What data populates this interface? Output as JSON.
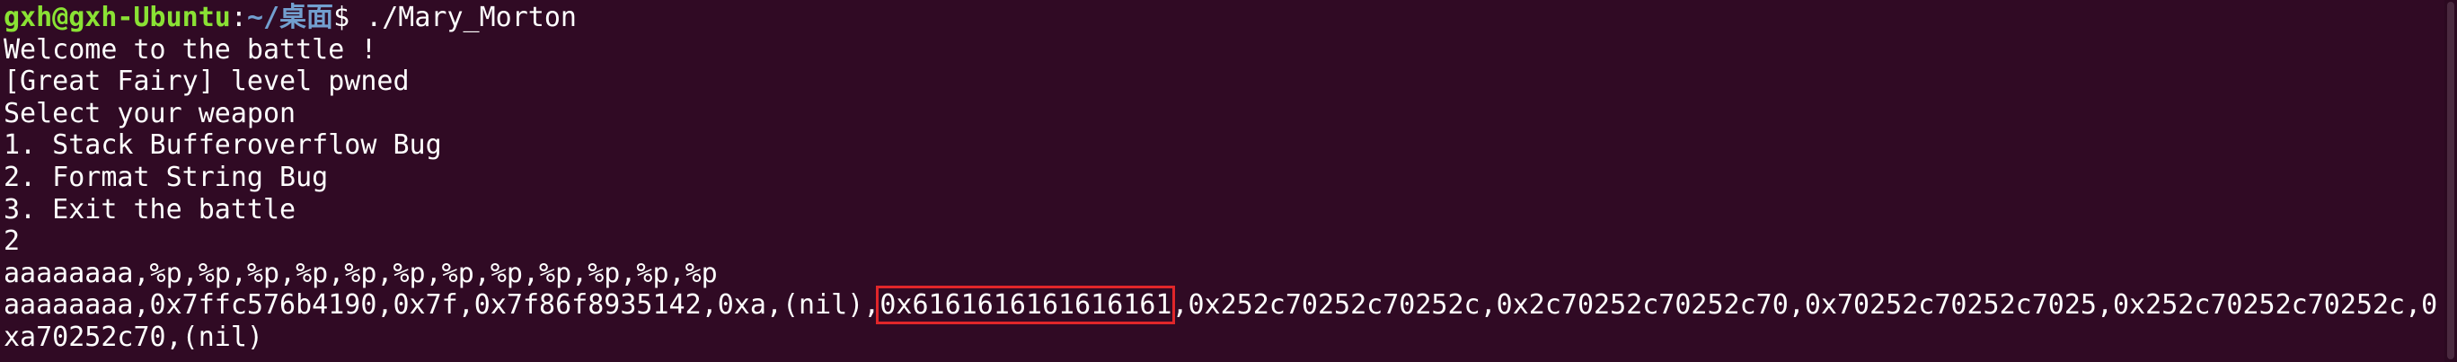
{
  "prompt": {
    "user_host": "gxh@gxh-Ubuntu",
    "separator": ":",
    "path": "~/桌面",
    "symbol": "$ ",
    "command": "./Mary_Morton"
  },
  "output_lines": [
    "Welcome to the battle !",
    "[Great Fairy] level pwned",
    "Select your weapon",
    "1. Stack Bufferoverflow Bug",
    "2. Format String Bug",
    "3. Exit the battle",
    "2",
    "aaaaaaaa,%p,%p,%p,%p,%p,%p,%p,%p,%p,%p,%p,%p"
  ],
  "leak_line": {
    "before": "aaaaaaaa,0x7ffc576b4190,0x7f,0x7f86f8935142,0xa,(nil),",
    "highlighted": "0x6161616161616161",
    "after": ",0x252c70252c70252c,0x2c70252c70252c70,0x70252c70252c7025,0x252c70252c70252c,0"
  },
  "wrap_line": "xa70252c70,(nil)",
  "colors": {
    "background": "#300a24",
    "text": "#ffffff",
    "prompt_user": "#8ae234",
    "prompt_path": "#729fcf",
    "highlight_box": "#e0262a"
  }
}
